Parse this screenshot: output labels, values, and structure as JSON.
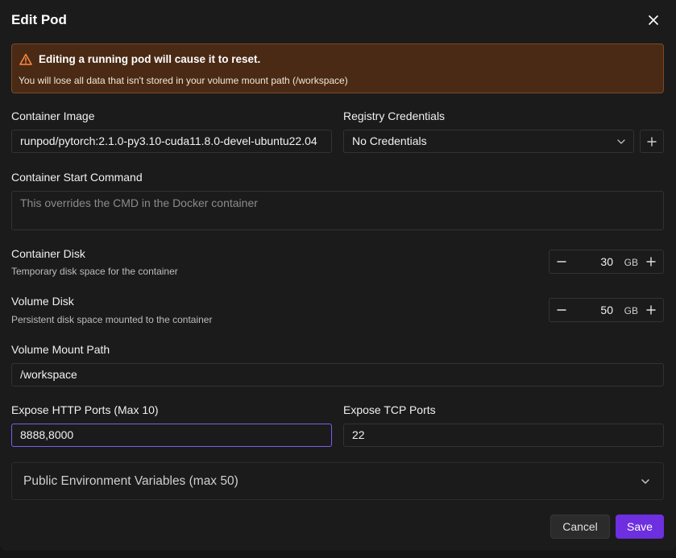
{
  "dialog": {
    "title": "Edit Pod"
  },
  "warning": {
    "title": "Editing a running pod will cause it to reset.",
    "text": "You will lose all data that isn't stored in your volume mount path (/workspace)"
  },
  "container_image": {
    "label": "Container Image",
    "value": "runpod/pytorch:2.1.0-py3.10-cuda11.8.0-devel-ubuntu22.04"
  },
  "registry_credentials": {
    "label": "Registry Credentials",
    "value": "No Credentials"
  },
  "start_command": {
    "label": "Container Start Command",
    "placeholder": "This overrides the CMD in the Docker container"
  },
  "container_disk": {
    "label": "Container Disk",
    "description": "Temporary disk space for the container",
    "value": "30",
    "unit": "GB"
  },
  "volume_disk": {
    "label": "Volume Disk",
    "description": "Persistent disk space mounted to the container",
    "value": "50",
    "unit": "GB"
  },
  "volume_mount_path": {
    "label": "Volume Mount Path",
    "value": "/workspace"
  },
  "http_ports": {
    "label": "Expose HTTP Ports (Max 10)",
    "value": "8888,8000"
  },
  "tcp_ports": {
    "label": "Expose TCP Ports",
    "value": "22"
  },
  "env_vars": {
    "label": "Public Environment Variables (max 50)"
  },
  "actions": {
    "cancel": "Cancel",
    "save": "Save"
  },
  "colors": {
    "accent": "#6d2fe0",
    "focus": "#7c5cf0",
    "warning_bg": "#4a2a14",
    "warning_icon": "#ff8a3d"
  }
}
